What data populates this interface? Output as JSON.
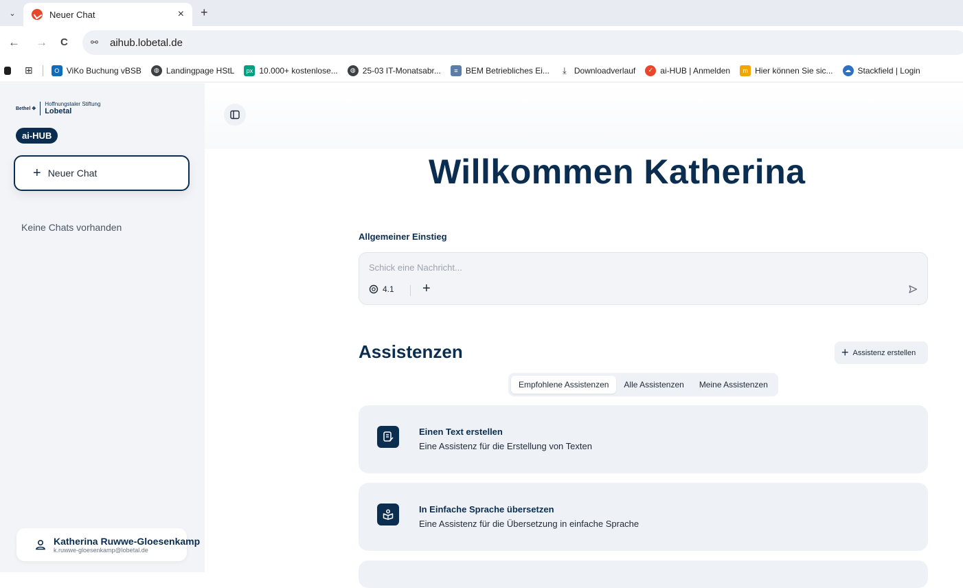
{
  "browser": {
    "tab_title": "Neuer Chat",
    "tab_close": "×",
    "new_tab": "+",
    "tab_menu": "⌄",
    "url": "aihub.lobetal.de",
    "back": "←",
    "forward": "→",
    "reload": "C",
    "bookmarks": [
      "ViKo Buchung vBSB",
      "Landingpage HStL",
      "10.000+ kostenlose...",
      "25-03 IT-Monatsabr...",
      "BEM Betriebliches Ei...",
      "Downloadverlauf",
      "ai-HUB | Anmelden",
      "Hier können Sie sic...",
      "Stackfield | Login"
    ]
  },
  "sidebar": {
    "logo_bethel": "Bethel ✥",
    "logo_line1": "Hoffnungstaler Stiftung",
    "logo_line2": "Lobetal",
    "badge": "ai-HUB",
    "new_chat_label": "Neuer Chat",
    "empty_text": "Keine Chats vorhanden",
    "user_name": "Katherina Ruwwe-Gloesenkamp",
    "user_email": "k.ruwwe-gloesenkamp@lobetal.de"
  },
  "main": {
    "welcome": "Willkommen Katherina",
    "section_label": "Allgemeiner Einstieg",
    "input_placeholder": "Schick eine Nachricht...",
    "model_version": "4.1",
    "assistants_title": "Assistenzen",
    "create_assistant": "Assistenz erstellen",
    "tabs": [
      {
        "label": "Empfohlene Assistenzen",
        "active": true
      },
      {
        "label": "Alle Assistenzen",
        "active": false
      },
      {
        "label": "Meine Assistenzen",
        "active": false
      }
    ],
    "cards": [
      {
        "title": "Einen Text erstellen",
        "description": "Eine Assistenz für die Erstellung von Texten",
        "icon": "document-edit-icon"
      },
      {
        "title": "In Einfache Sprache übersetzen",
        "description": "Eine Assistenz für die Übersetzung in einfache Sprache",
        "icon": "book-person-icon"
      }
    ]
  },
  "colors": {
    "brand_navy": "#0b2d4f",
    "sidebar_bg": "#f2f4f7",
    "card_bg": "#eef1f5"
  }
}
